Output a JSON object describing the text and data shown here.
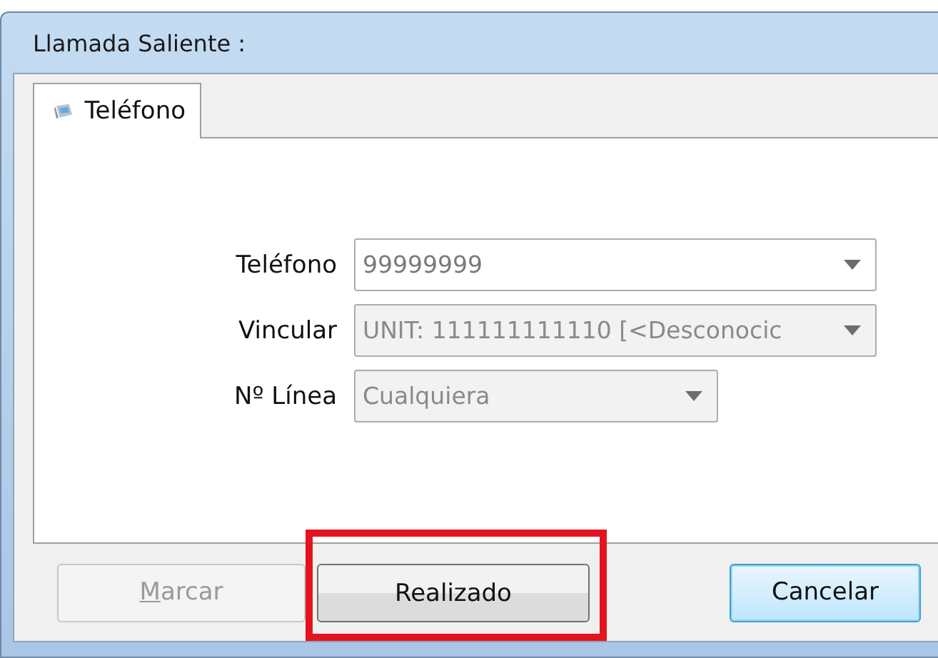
{
  "window": {
    "title": "Llamada Saliente :"
  },
  "tabs": [
    {
      "label": "Teléfono",
      "selected": true
    }
  ],
  "fields": [
    {
      "label": "Teléfono",
      "value": "99999999",
      "disabled": false,
      "wide": true
    },
    {
      "label": "Vincular",
      "value": "UNIT: 111111111110 [<Desconocic",
      "disabled": true,
      "wide": true
    },
    {
      "label": "Nº Línea",
      "value": "Cualquiera",
      "disabled": true,
      "wide": false
    }
  ],
  "buttons": [
    {
      "label": "Marcar",
      "disabled": true,
      "default": false,
      "highlighted": false,
      "mnemonic": true
    },
    {
      "label": "Realizado",
      "disabled": false,
      "default": false,
      "highlighted": true,
      "mnemonic": false
    },
    {
      "label": "Cancelar",
      "disabled": false,
      "default": true,
      "highlighted": false,
      "mnemonic": false
    }
  ]
}
